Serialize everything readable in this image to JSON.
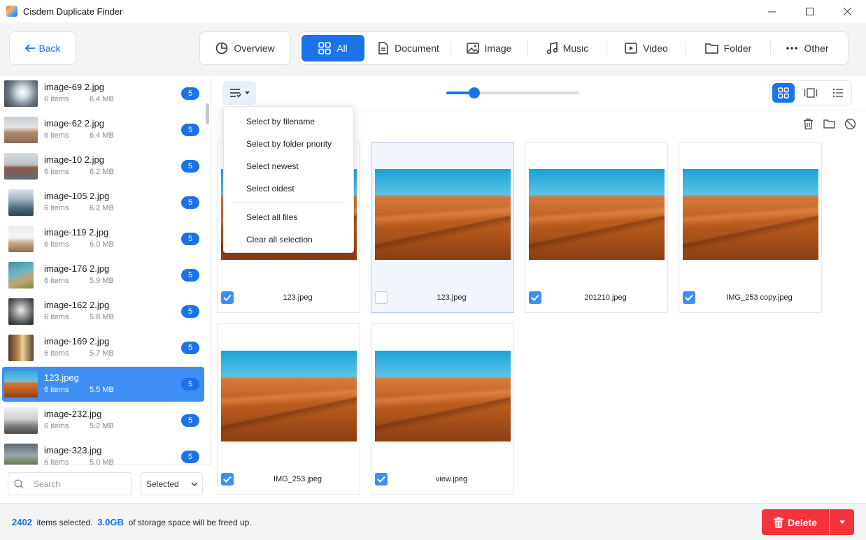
{
  "window": {
    "title": "Cisdem Duplicate Finder"
  },
  "nav": {
    "back_label": "Back",
    "overview_label": "Overview",
    "tabs": [
      {
        "label": "All",
        "icon": "grid-icon",
        "active": true
      },
      {
        "label": "Document",
        "icon": "document-icon",
        "active": false
      },
      {
        "label": "Image",
        "icon": "image-icon",
        "active": false
      },
      {
        "label": "Music",
        "icon": "music-icon",
        "active": false
      },
      {
        "label": "Video",
        "icon": "video-icon",
        "active": false
      },
      {
        "label": "Folder",
        "icon": "folder-icon",
        "active": false
      },
      {
        "label": "Other",
        "icon": "more-icon",
        "active": false
      }
    ]
  },
  "sidebar": {
    "items": [
      {
        "name": "image-69 2.jpg",
        "count": "6 items",
        "size": "6.4 MB",
        "badge": "5"
      },
      {
        "name": "image-62 2.jpg",
        "count": "6 items",
        "size": "6.4 MB",
        "badge": "5"
      },
      {
        "name": "image-10 2.jpg",
        "count": "6 items",
        "size": "6.2 MB",
        "badge": "5"
      },
      {
        "name": "image-105 2.jpg",
        "count": "6 items",
        "size": "6.2 MB",
        "badge": "5"
      },
      {
        "name": "image-119 2.jpg",
        "count": "6 items",
        "size": "6.0 MB",
        "badge": "5"
      },
      {
        "name": "image-176 2.jpg",
        "count": "6 items",
        "size": "5.9 MB",
        "badge": "5"
      },
      {
        "name": "image-162 2.jpg",
        "count": "6 items",
        "size": "5.8 MB",
        "badge": "5"
      },
      {
        "name": "image-169 2.jpg",
        "count": "6 items",
        "size": "5.7 MB",
        "badge": "5"
      },
      {
        "name": "123.jpeg",
        "count": "6 items",
        "size": "5.5 MB",
        "badge": "5",
        "selected": true
      },
      {
        "name": "image-232.jpg",
        "count": "6 items",
        "size": "5.2 MB",
        "badge": "5"
      },
      {
        "name": "image-323.jpg",
        "count": "6 items",
        "size": "5.0 MB",
        "badge": "5"
      }
    ],
    "search_placeholder": "Search",
    "filter_value": "Selected"
  },
  "toolbar": {
    "thumbnail_size": 0.21
  },
  "sort_menu": {
    "items": [
      "Select by filename",
      "Select by folder priority",
      "Select newest",
      "Select oldest",
      "Select all files",
      "Clear all selection"
    ]
  },
  "files": [
    {
      "name": "123.jpeg",
      "checked": true
    },
    {
      "name": "123.jpeg",
      "checked": false,
      "highlight": true
    },
    {
      "name": "201210.jpeg",
      "checked": true
    },
    {
      "name": "IMG_253 copy.jpeg",
      "checked": true
    },
    {
      "name": "IMG_253.jpeg",
      "checked": true
    },
    {
      "name": "view.jpeg",
      "checked": true
    }
  ],
  "status": {
    "selected_count": "2402",
    "selected_text": "items selected.",
    "freed_size": "3.0GB",
    "freed_text": "of storage space will be freed up."
  },
  "delete_label": "Delete",
  "colors": {
    "accent": "#1a73e8",
    "danger": "#f3343b"
  }
}
